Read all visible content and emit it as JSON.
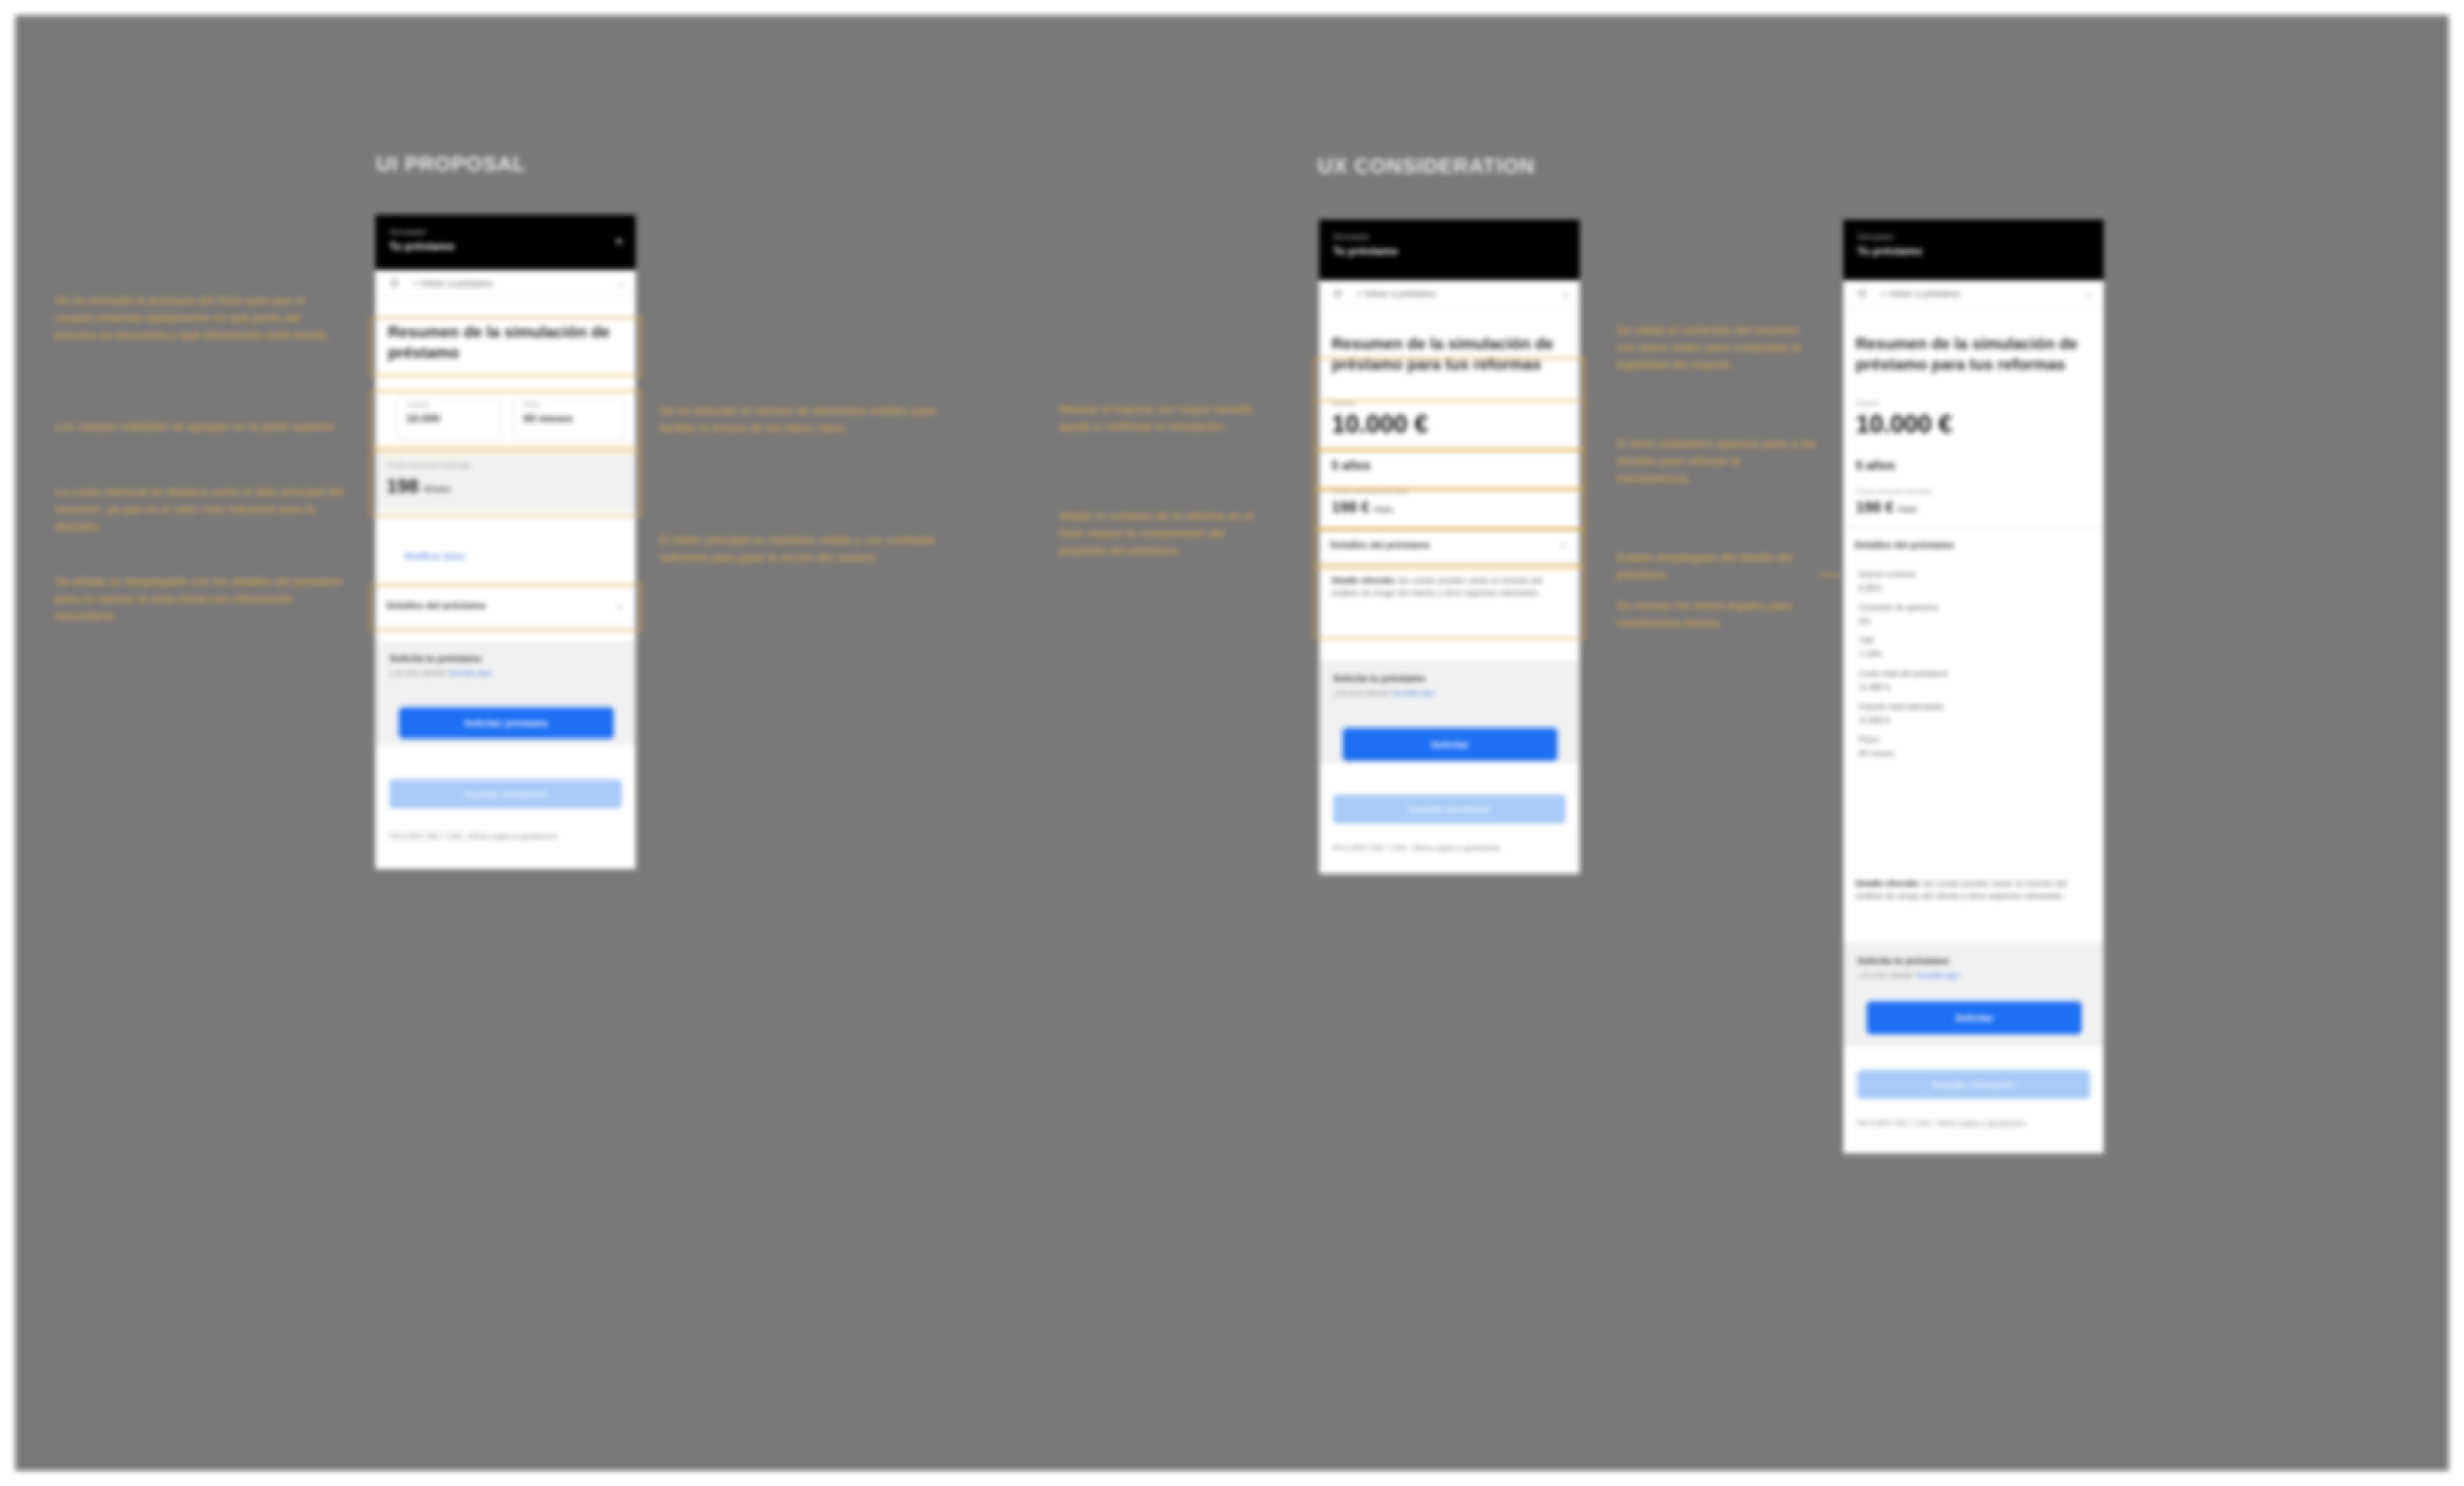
{
  "sections": {
    "proposal_title": "UI PROPOSAL",
    "consideration_title": "UX CONSIDERATION"
  },
  "phone": {
    "header_small": "Simulador",
    "header_title": "Tu préstamo",
    "close_icon": "×",
    "nav_label": "< Volver a préstamo",
    "heading_1": "Resumen de la simulación de préstamo",
    "heading_2": "Resumen de la simulación de préstamo para tus reformas",
    "amount_caption": "Importe",
    "amount_value": "10.000",
    "term_caption": "Plazo",
    "term_value": "60 meses",
    "fee_caption": "Cuota mensual estimada",
    "fee_value": "198",
    "fee_unit": "€/mes",
    "edit_link": "Modificar datos",
    "details_label": "Detalles del préstamo",
    "cta_title": "Solicita tu préstamo",
    "cta_sub": "¿Ya eres cliente?",
    "cta_sub_link": "Accede aquí",
    "primary_button_1": "Solicitar préstamo",
    "primary_button_2": "Solicitar",
    "secondary_button": "Guardar simulación",
    "legal": "TIN 6,95% TAE 7,19%. Oferta sujeta a aprobación.",
    "big_amount": "10.000 €",
    "term_big": "5 años",
    "fee_big": "198 €",
    "fee_big_unit": "/mes",
    "detail_strong": "Detalle ofrecido:",
    "detail_text": "las cuotas pueden variar en función del análisis de riesgo del cliente y otros aspectos relevantes."
  },
  "detail_list": [
    "Interés nominal",
    "6,95%",
    "Comisión de apertura",
    "0%",
    "TAE",
    "7,19%",
    "Coste total del préstamo",
    "11.880 €",
    "Importe total adeudado",
    "11.880 €",
    "Plazo",
    "60 meses"
  ],
  "notes": {
    "left_1": "Se ha revisado la jerarquía del título para que el usuario entienda rápidamente en qué punto del proceso se encuentra y qué información está viendo.",
    "left_2": "Los campos editables se agrupan en la parte superior.",
    "left_3": "La cuota mensual se destaca como el dato principal del resumen, ya que es el valor más relevante para la decisión.",
    "left_4": "Se añade un desplegable con los detalles del préstamo para no saturar la vista inicial con información secundaria.",
    "mid_1": "Se ha reducido el número de elementos visibles para facilitar la lectura de los datos clave.",
    "mid_2": "El botón principal se mantiene visible y con contraste suficiente para guiar la acción del usuario.",
    "cons_1": "Mostrar el importe con mayor tamaño ayuda a confirmar la simulación.",
    "cons_2": "Añadir el contexto de la reforma en el título mejora la comprensión del propósito del préstamo.",
    "right_1": "Se valida el contenido del resumen con datos reales para comprobar la legibilidad del importe.",
    "right_2": "El texto aclaratorio aparece junto a los detalles para reforzar la transparencia.",
    "right_3": "Estado desplegado del detalle del préstamo.",
    "right_4": "Se revisan los textos legales para mantenerlos breves."
  },
  "colors": {
    "canvas": "#7a7a7a",
    "annotation": "#d9a446",
    "primary": "#1f6ff2",
    "primary_light": "#a9c9f7",
    "header": "#000000"
  }
}
